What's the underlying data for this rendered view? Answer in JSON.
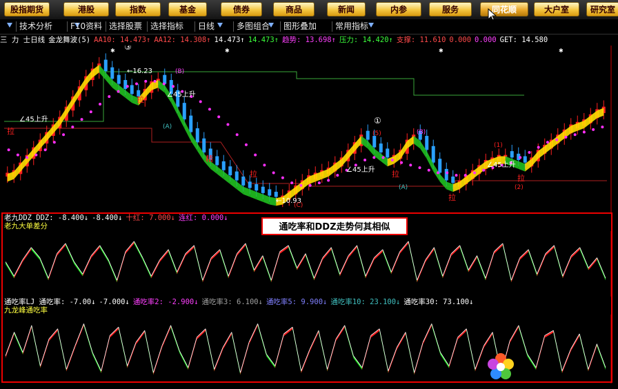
{
  "nav": {
    "items": [
      "股指期货",
      "港股",
      "指数",
      "基金",
      "债券",
      "商品",
      "新闻",
      "内参",
      "服务",
      "同花顺",
      "大户室",
      "研究室"
    ],
    "active_index": 9
  },
  "toolbar": {
    "items": [
      {
        "label": "技术分析",
        "arrow": true
      },
      {
        "label": "F10资料",
        "arrow": false
      },
      {
        "label": "选择股票",
        "arrow": false
      },
      {
        "label": "选择指标",
        "arrow": false
      },
      {
        "label": "日线",
        "arrow": true
      },
      {
        "label": "多图组合",
        "arrow": true
      },
      {
        "label": "图形叠加",
        "arrow": false
      },
      {
        "label": "常用指标",
        "arrow": true
      }
    ]
  },
  "main_info": {
    "items": [
      {
        "text": "三 力 士日线",
        "color": "#ffffff"
      },
      {
        "text": "金龙舞波(5)",
        "color": "#ffffff"
      },
      {
        "text": "AA10: 14.473↑",
        "color": "#ff4a4a"
      },
      {
        "text": "AA12: 14.308↑",
        "color": "#ff4a4a"
      },
      {
        "text": "14.473↑",
        "color": "#ffffff"
      },
      {
        "text": "14.473↑",
        "color": "#3cff3c"
      },
      {
        "text": "趋势: 13.698↑",
        "color": "#ff40ff"
      },
      {
        "text": "压力: 14.420↑",
        "color": "#3cff3c"
      },
      {
        "text": "支撑: 11.610",
        "color": "#ff4a4a"
      },
      {
        "text": "0.000",
        "color": "#ff4a4a"
      },
      {
        "text": "0.000",
        "color": "#ff40ff"
      },
      {
        "text": "GET: 14.580",
        "color": "#ffffff"
      }
    ]
  },
  "main_annotations": {
    "high_price": "16.23",
    "low_price": "10.93",
    "angle_labels": [
      "∠45上升",
      "∠45上升",
      "∠45上升",
      "∠45上升",
      "∠45上升"
    ],
    "pull_labels": [
      "拉",
      "拉",
      "拉",
      "拉",
      "拉",
      "拉"
    ],
    "cut_label": "精",
    "circled": [
      "③",
      "①",
      "(A)",
      "(B)",
      "(C)",
      "(A)",
      "(B)",
      "(1)",
      "(2)",
      "(5)"
    ]
  },
  "pane2": {
    "line1": [
      {
        "text": "老九DDZ DDZ: -8.400↓",
        "color": "#ffffff"
      },
      {
        "text": "-8.400↓",
        "color": "#ffffff"
      },
      {
        "text": "十红: 7.000↓",
        "color": "#ff4a4a"
      },
      {
        "text": "连红: 0.000↓",
        "color": "#ff40ff"
      }
    ],
    "line2": {
      "text": "老九大单差分",
      "color": "#ffff40"
    },
    "annotation": "通吃率和DDZ走势何其相似"
  },
  "pane3": {
    "line1": [
      {
        "text": "通吃率LJ 通吃率: -7.00↓",
        "color": "#ffffff"
      },
      {
        "text": "-7.000↓",
        "color": "#ffffff"
      },
      {
        "text": "通吃率2: -2.900↓",
        "color": "#ff40ff"
      },
      {
        "text": "通吃率3: 6.100↓",
        "color": "#a0a0a0"
      },
      {
        "text": "通吃率5: 9.900↓",
        "color": "#8080ff"
      },
      {
        "text": "通吃率10: 23.100↓",
        "color": "#40c0c0"
      },
      {
        "text": "通吃率30: 73.100↓",
        "color": "#ffffff"
      }
    ],
    "line2": {
      "text": "九龙峰通吃率",
      "color": "#ffff40"
    }
  },
  "chart_data": {
    "type": "line",
    "price": {
      "name": "三力士",
      "values": [
        11.9,
        12.0,
        12.3,
        12.6,
        12.9,
        13.2,
        13.5,
        13.8,
        14.1,
        14.5,
        14.9,
        15.3,
        15.7,
        16.0,
        16.2,
        15.9,
        15.6,
        15.4,
        15.2,
        15.0,
        14.9,
        15.2,
        15.5,
        15.6,
        15.4,
        15.0,
        14.5,
        14.0,
        13.5,
        13.1,
        12.7,
        12.4,
        12.2,
        12.0,
        11.8,
        11.6,
        11.4,
        11.3,
        11.2,
        11.1,
        11.0,
        10.95,
        11.0,
        11.2,
        11.4,
        11.6,
        11.8,
        11.9,
        12.0,
        12.1,
        12.3,
        12.5,
        12.8,
        13.1,
        13.4,
        13.2,
        12.9,
        12.7,
        12.5,
        12.6,
        12.8,
        13.2,
        13.4,
        13.2,
        12.8,
        12.3,
        11.9,
        11.6,
        11.5,
        11.6,
        11.8,
        12.0,
        12.2,
        12.4,
        12.5,
        12.6,
        12.6,
        12.5,
        12.4,
        12.3,
        12.5,
        12.8,
        13.0,
        13.2,
        13.4,
        13.6,
        13.8,
        13.9,
        14.0,
        14.2,
        14.4,
        14.5
      ],
      "ylim": [
        10.5,
        16.8
      ]
    },
    "trend": {
      "name": "趋势",
      "values": [
        12.8,
        12.6,
        12.5,
        12.6,
        12.8,
        13.1,
        13.4,
        13.7,
        14.0,
        14.3,
        14.6,
        14.9,
        15.1,
        15.3,
        15.4,
        15.5,
        15.5,
        15.4,
        15.3,
        15.1,
        14.9,
        14.7,
        14.4,
        14.1,
        13.8,
        13.4,
        13.0,
        12.6,
        12.2,
        11.9,
        11.7,
        11.5,
        11.4,
        11.4,
        11.5,
        11.6,
        11.8,
        12.0,
        12.2,
        12.4,
        12.5,
        12.5,
        12.4,
        12.3,
        12.2,
        12.1,
        12.0,
        11.9,
        11.9,
        11.8,
        11.8,
        11.9,
        12.0,
        12.1,
        12.2,
        12.3,
        12.5,
        12.7,
        12.9,
        13.1,
        13.2,
        13.3,
        13.4,
        13.5,
        13.6,
        13.7
      ],
      "ylim": [
        10.5,
        16.8
      ]
    },
    "ddz": {
      "name": "DDZ",
      "values": [
        1,
        -6,
        2,
        8,
        3,
        -7,
        5,
        10,
        1,
        -5,
        4,
        9,
        2,
        -8,
        6,
        11,
        3,
        -6,
        2,
        7,
        -4,
        5,
        9,
        -8,
        3,
        7,
        -6,
        5,
        10,
        -3,
        4,
        -8,
        6,
        9,
        -2,
        5,
        -7,
        3,
        8,
        -5,
        4,
        9,
        -6,
        3,
        7,
        -4,
        6,
        11,
        -8,
        2,
        8,
        -6,
        5,
        9,
        -3,
        4,
        -7,
        6,
        10,
        -8,
        3,
        7,
        -5,
        5,
        9,
        -6,
        4,
        8,
        -2,
        3,
        -7
      ],
      "ylim": [
        -14,
        14
      ]
    },
    "tcl": {
      "name": "通吃率",
      "values": [
        0,
        14,
        2,
        18,
        -6,
        10,
        16,
        -8,
        6,
        19,
        2,
        -9,
        12,
        17,
        -6,
        8,
        15,
        -10,
        6,
        18,
        3,
        -7,
        11,
        16,
        -8,
        5,
        14,
        -10,
        8,
        19,
        1,
        -6,
        13,
        17,
        -9,
        4,
        15,
        -8,
        10,
        18,
        0,
        -7,
        12,
        16,
        -9,
        5,
        14,
        -10,
        8,
        19,
        2,
        -6,
        11,
        16,
        -8,
        6,
        14,
        -10,
        9,
        18,
        1,
        -7,
        12,
        15,
        -9,
        4,
        13,
        -8,
        7,
        -7
      ],
      "ylim": [
        -14,
        22
      ]
    }
  }
}
